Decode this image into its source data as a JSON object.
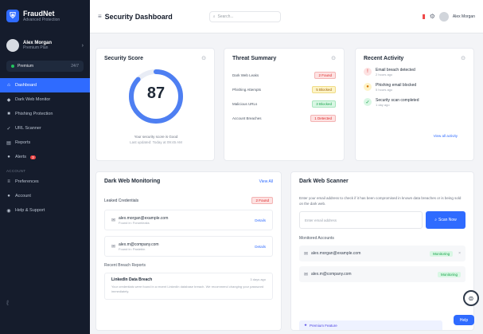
{
  "app": {
    "name": "FraudNet",
    "tagline": "Advanced Protection"
  },
  "user": {
    "name": "Alex Morgan",
    "plan": "Premium Plan"
  },
  "plan_pill": {
    "label": "Premium",
    "value": "24/7"
  },
  "sidebar": {
    "items": [
      {
        "label": "Dashboard",
        "icon": "home-icon",
        "active": true
      },
      {
        "label": "Dark Web Monitor",
        "icon": "shield-icon",
        "active": false
      },
      {
        "label": "Phishing Protection",
        "icon": "mail-icon",
        "active": false
      },
      {
        "label": "URL Scanner",
        "icon": "link-icon",
        "active": false
      },
      {
        "label": "Reports",
        "icon": "chart-icon",
        "active": false
      },
      {
        "label": "Alerts",
        "icon": "bell-icon",
        "active": false,
        "badge": "3"
      }
    ],
    "section_label": "ACCOUNT",
    "account_items": [
      {
        "label": "Preferences",
        "icon": "sliders-icon"
      },
      {
        "label": "Account",
        "icon": "user-icon"
      },
      {
        "label": "Help & Support",
        "icon": "help-icon"
      }
    ]
  },
  "topbar": {
    "title": "Security Dashboard",
    "search_placeholder": "Search...",
    "username": "Alex Morgan"
  },
  "score_card": {
    "title": "Security Score",
    "score": "87",
    "score_fraction": 0.87,
    "line1": "Your security score is Good",
    "line2": "Last updated: Today at 09:45 AM"
  },
  "threat_card": {
    "title": "Threat Summary",
    "rows": [
      {
        "label": "Dark Web Leaks",
        "badge": "2 Found",
        "color": "red"
      },
      {
        "label": "Phishing Attempts",
        "badge": "5 Blocked",
        "color": "yellow"
      },
      {
        "label": "Malicious URLs",
        "badge": "3 Blocked",
        "color": "green"
      },
      {
        "label": "Account Breaches",
        "badge": "1 Detected",
        "color": "red"
      }
    ]
  },
  "activity_card": {
    "title": "Recent Activity",
    "items": [
      {
        "title": "Email breach detected",
        "time": "2 hours ago",
        "color": "red",
        "icon": "!"
      },
      {
        "title": "Phishing email blocked",
        "time": "5 hours ago",
        "color": "yellow",
        "icon": "●"
      },
      {
        "title": "Security scan completed",
        "time": "1 day ago",
        "color": "green",
        "icon": "✓"
      }
    ],
    "view_all": "View all activity"
  },
  "darkweb_card": {
    "title": "Dark Web Monitoring",
    "link": "View All",
    "leaked_label": "Leaked Credentials",
    "leaked_badge": "2 Found",
    "credentials": [
      {
        "email": "alex.morgan@example.com",
        "source": "Found in: Forumleaks",
        "action": "Details"
      },
      {
        "email": "alex.m@company.com",
        "source": "Found in: Pastebin",
        "action": "Details"
      }
    ],
    "reports_label": "Recent Breach Reports",
    "report": {
      "title": "LinkedIn Data Breach",
      "time": "3 days ago",
      "desc": "Your credentials were found in a recent LinkedIn database breach. We recommend changing your password immediately."
    }
  },
  "scanner_card": {
    "title": "Dark Web Scanner",
    "desc": "Enter your email address to check if it has been compromised in known data breaches or is being sold on the dark web.",
    "input_placeholder": "Enter email address",
    "button": "Scan Now",
    "monitored_label": "Monitored Accounts",
    "accounts": [
      {
        "email": "alex.morgan@example.com",
        "status": "Monitoring"
      },
      {
        "email": "alex.m@company.com",
        "status": "Monitoring"
      }
    ],
    "premium": "Premium Feature"
  },
  "help_button": "Help",
  "colors": {
    "accent": "#2f6bff",
    "sidebar": "#151c2c",
    "danger": "#ef4444",
    "success": "#16a34a",
    "warning": "#d97706"
  }
}
